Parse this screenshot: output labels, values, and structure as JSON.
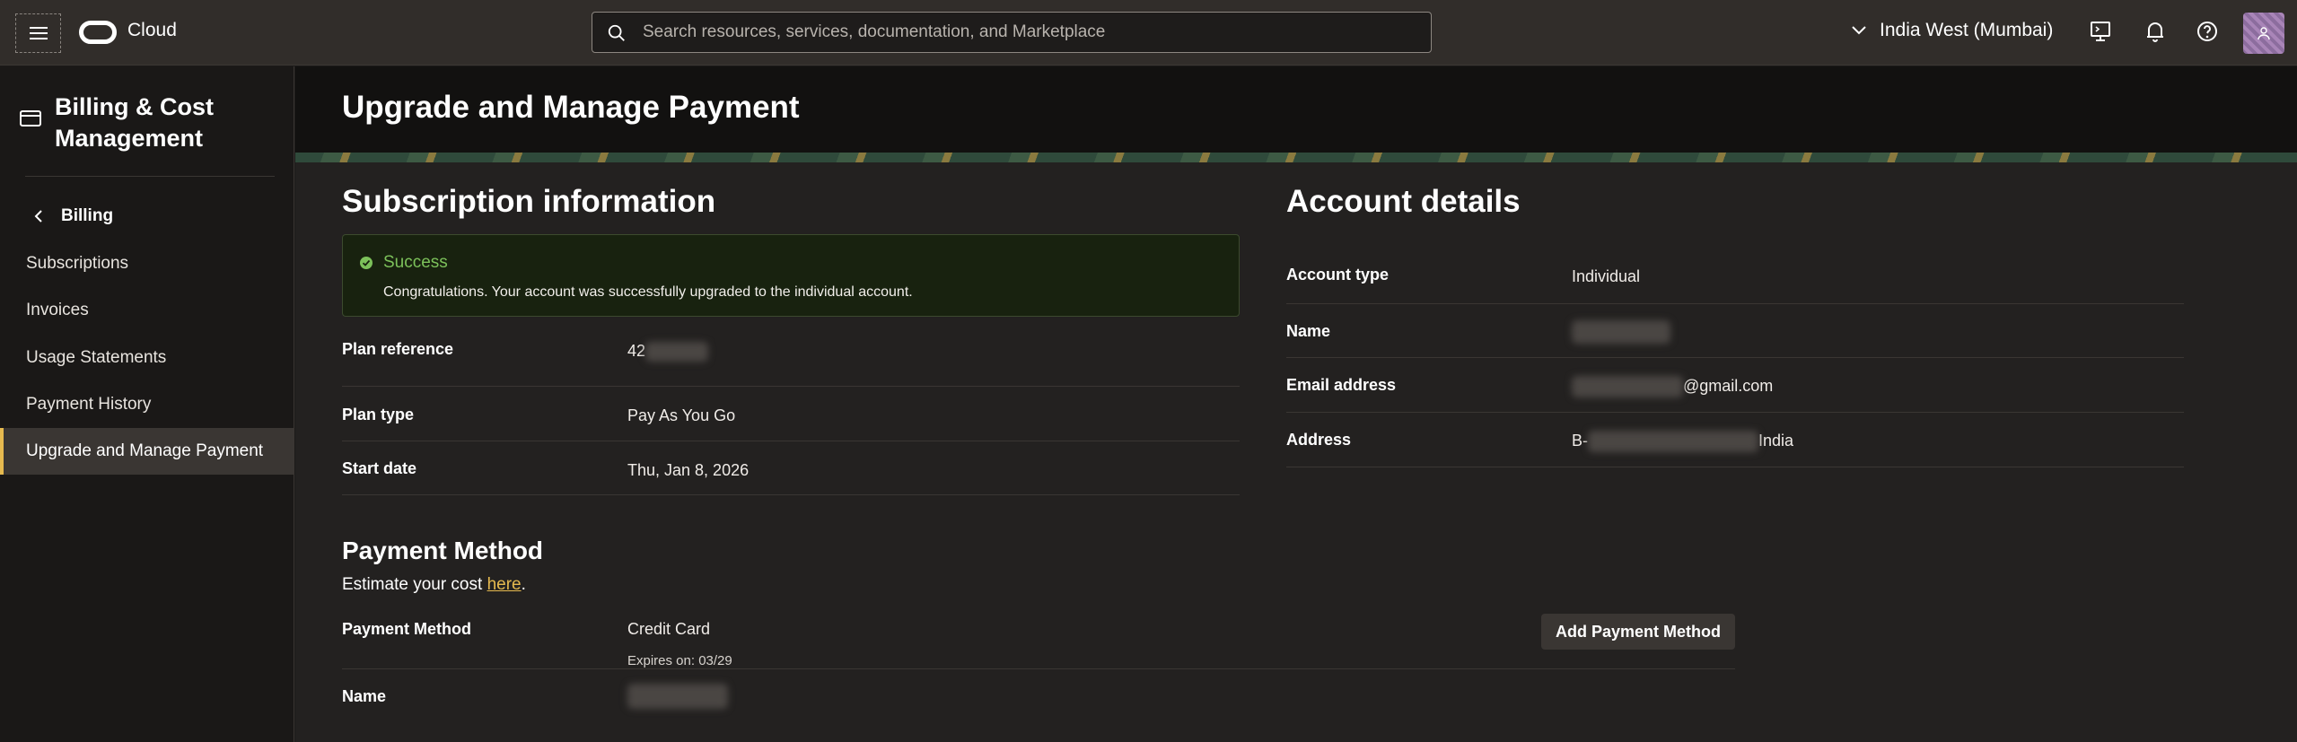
{
  "topbar": {
    "brand": "Cloud",
    "search_placeholder": "Search resources, services, documentation, and Marketplace",
    "region": "India West (Mumbai)"
  },
  "sidebar": {
    "title": "Billing & Cost Management",
    "back_label": "Billing",
    "items": [
      {
        "label": "Subscriptions"
      },
      {
        "label": "Invoices"
      },
      {
        "label": "Usage Statements"
      },
      {
        "label": "Payment History"
      },
      {
        "label": "Upgrade and Manage Payment"
      }
    ]
  },
  "page": {
    "title": "Upgrade and Manage Payment"
  },
  "subscription": {
    "title": "Subscription information",
    "success_title": "Success",
    "success_message": "Congratulations. Your account was successfully upgraded to the individual account.",
    "rows": [
      {
        "label": "Plan reference",
        "value": "42"
      },
      {
        "label": "Plan type",
        "value": "Pay As You Go"
      },
      {
        "label": "Start date",
        "value": "Thu, Jan 8, 2026"
      }
    ]
  },
  "account": {
    "title": "Account details",
    "rows": [
      {
        "label": "Account type",
        "value": "Individual"
      },
      {
        "label": "Name",
        "value": ""
      },
      {
        "label": "Email address",
        "value": "@gmail.com"
      },
      {
        "label": "Address",
        "value_prefix": "B-",
        "value_suffix": "India"
      }
    ]
  },
  "payment": {
    "title": "Payment Method",
    "estimate_prefix": "Estimate your cost ",
    "estimate_link": "here",
    "estimate_suffix": ".",
    "method_label": "Payment Method",
    "method_value": "Credit Card",
    "expires": "Expires on: 03/29",
    "add_button": "Add Payment Method",
    "name_label": "Name"
  },
  "colors": {
    "accent": "#e5b94f",
    "success": "#7cc15a",
    "topbar": "#312d2a"
  }
}
